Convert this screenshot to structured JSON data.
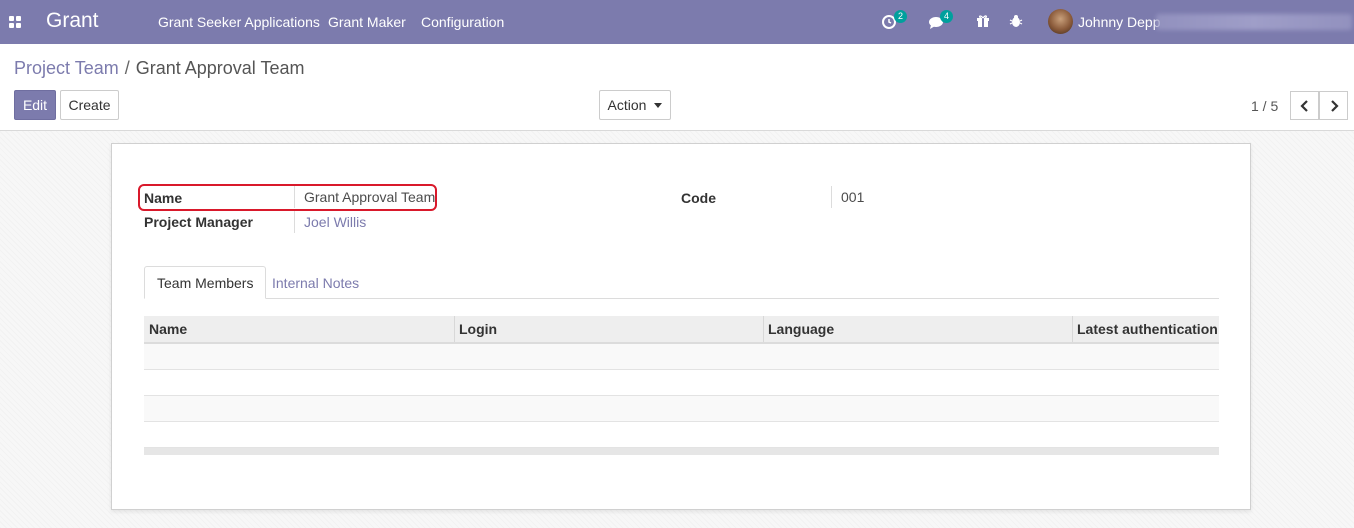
{
  "navbar": {
    "brand": "Grant",
    "menu": [
      "Grant Seeker Applications",
      "Grant Maker",
      "Configuration"
    ],
    "activity_count": "2",
    "message_count": "4",
    "user_name": "Johnny Depp"
  },
  "breadcrumb": {
    "parent": "Project Team",
    "separator": "/",
    "current": "Grant Approval Team"
  },
  "actions": {
    "edit_label": "Edit",
    "create_label": "Create",
    "action_label": "Action"
  },
  "pager": {
    "value": "1 / 5"
  },
  "form": {
    "name_label": "Name",
    "name_value": "Grant Approval Team",
    "manager_label": "Project Manager",
    "manager_value": "Joel Willis",
    "code_label": "Code",
    "code_value": "001"
  },
  "tabs": [
    "Team Members",
    "Internal Notes"
  ],
  "table": {
    "columns": [
      "Name",
      "Login",
      "Language",
      "Latest authentication"
    ],
    "rows": []
  },
  "colors": {
    "brand": "#7c7bad",
    "badge": "#00a09d",
    "highlight": "#d9192b"
  }
}
